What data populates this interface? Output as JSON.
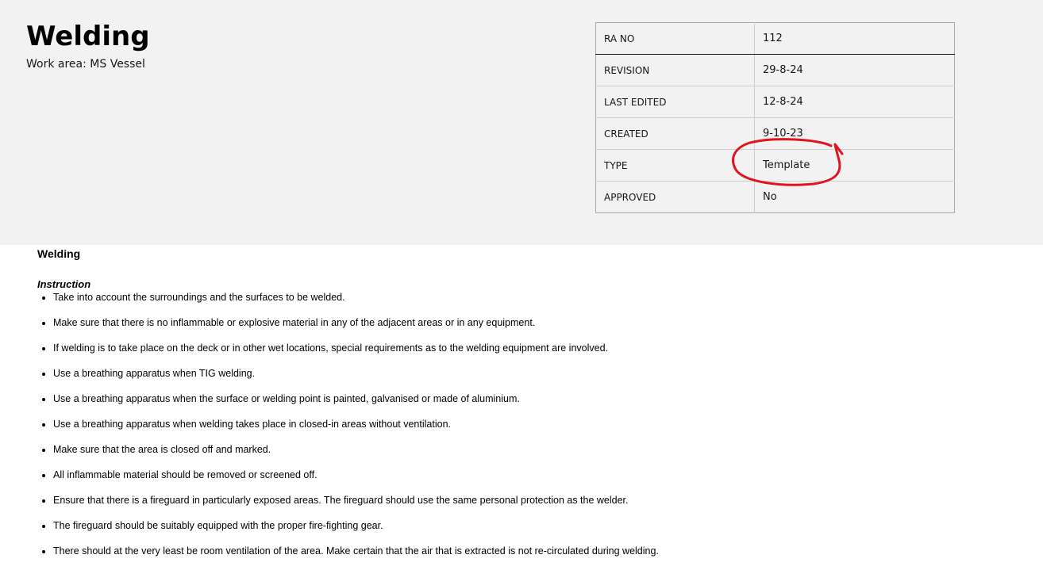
{
  "header": {
    "title": "Welding",
    "work_area": "Work area: MS Vessel"
  },
  "info_table": [
    {
      "key": "RA NO",
      "value": "112"
    },
    {
      "key": "REVISION",
      "value": "29-8-24"
    },
    {
      "key": "LAST EDITED",
      "value": "12-8-24"
    },
    {
      "key": "CREATED",
      "value": "9-10-23"
    },
    {
      "key": "TYPE",
      "value": "Template"
    },
    {
      "key": "APPROVED",
      "value": "No"
    }
  ],
  "annotation": {
    "color": "#e0141e",
    "target": "TYPE value"
  },
  "section": {
    "title": "Welding",
    "subtitle": "Instruction",
    "items": [
      "Take into account the surroundings and the surfaces to be welded.",
      "Make sure that there is no inflammable or explosive material in any of the adjacent areas or in any equipment.",
      "If welding is to take place on the deck or in other wet locations, special requirements as to the welding equipment are involved.",
      "Use a breathing apparatus when TIG welding.",
      "Use a breathing apparatus when the surface or welding point is painted, galvanised or made of aluminium.",
      "Use a breathing apparatus when welding takes place in closed-in areas without ventilation.",
      "Make sure that the area is closed off and marked.",
      "All inflammable material should be removed or screened off.",
      "Ensure that there is a fireguard in particularly exposed areas. The fireguard should use the same personal protection as the welder.",
      "The fireguard should be suitably equipped with the proper fire-fighting gear.",
      "There should at the very least be room ventilation of the area. Make certain that the air that is extracted is not re-circulated during welding."
    ]
  }
}
